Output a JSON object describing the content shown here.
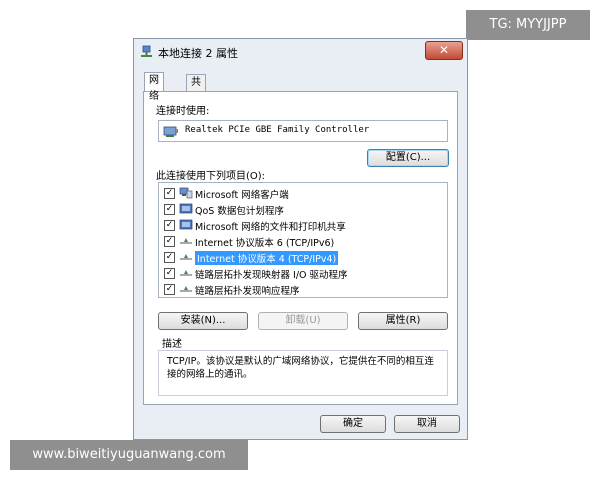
{
  "watermarks": {
    "top_right": "TG: MYYJJPP",
    "bottom_left": "www.biweitiyuguanwang.com"
  },
  "dialog": {
    "title": "本地连接 2 属性",
    "close_label": "✕",
    "tabs": [
      {
        "label": "网络",
        "active": true
      },
      {
        "label": "共享",
        "active": false
      }
    ],
    "connect_using_label": "连接时使用:",
    "adapter_name": "Realtek PCIe GBE Family Controller",
    "configure_button": "配置(C)...",
    "items_label": "此连接使用下列项目(O):",
    "items": [
      {
        "label": "Microsoft 网络客户端",
        "checked": true,
        "icon": "network-client-icon"
      },
      {
        "label": "QoS 数据包计划程序",
        "checked": true,
        "icon": "qos-icon"
      },
      {
        "label": "Microsoft 网络的文件和打印机共享",
        "checked": true,
        "icon": "file-printer-share-icon"
      },
      {
        "label": "Internet 协议版本 6 (TCP/IPv6)",
        "checked": true,
        "icon": "protocol-icon"
      },
      {
        "label": "Internet 协议版本 4 (TCP/IPv4)",
        "checked": true,
        "icon": "protocol-icon",
        "selected": true
      },
      {
        "label": "链路层拓扑发现映射器 I/O 驱动程序",
        "checked": true,
        "icon": "protocol-icon"
      },
      {
        "label": "链路层拓扑发现响应程序",
        "checked": true,
        "icon": "protocol-icon"
      }
    ],
    "install_button": "安装(N)...",
    "uninstall_button": "卸载(U)",
    "properties_button": "属性(R)",
    "description_label": "描述",
    "description_text": "TCP/IP。该协议是默认的广域网络协议，它提供在不同的相互连接的网络上的通讯。",
    "ok_button": "确定",
    "cancel_button": "取消"
  }
}
